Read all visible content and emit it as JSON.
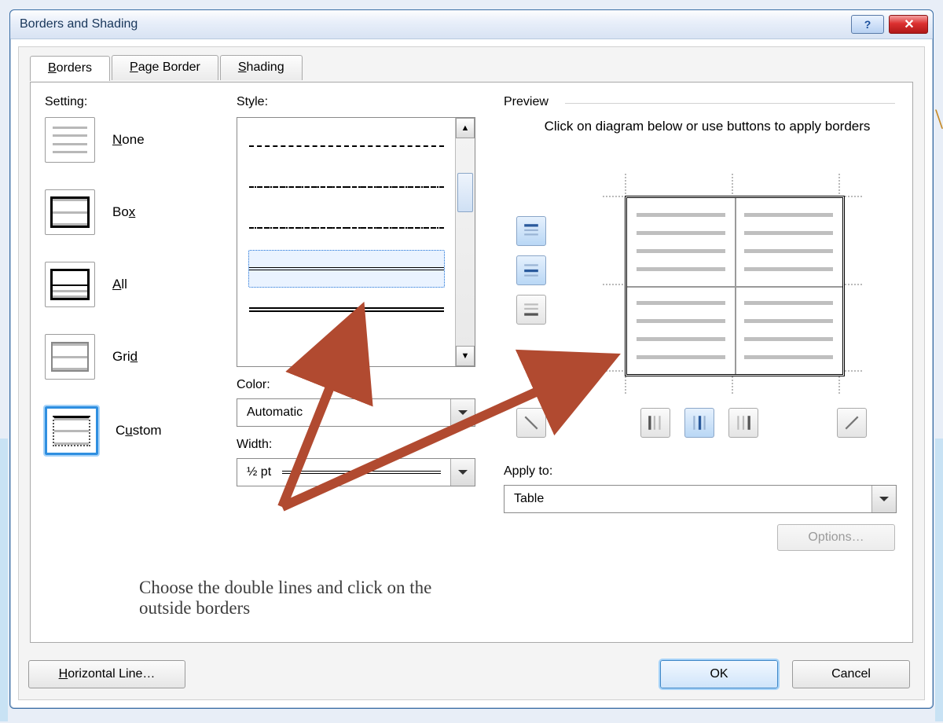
{
  "dialog": {
    "title": "Borders and Shading",
    "help_glyph": "?",
    "close_glyph": "✕"
  },
  "tabs": {
    "borders": "Borders",
    "page_border": "Page Border",
    "shading": "Shading"
  },
  "labels": {
    "setting": "Setting:",
    "style": "Style:",
    "color": "Color:",
    "width": "Width:",
    "preview": "Preview",
    "preview_help": "Click on diagram below or use buttons to apply borders",
    "apply_to": "Apply to:"
  },
  "setting_options": {
    "none": "None",
    "box": "Box",
    "all": "All",
    "grid": "Grid",
    "custom": "Custom"
  },
  "color": {
    "value": "Automatic"
  },
  "width": {
    "value": "½ pt"
  },
  "apply_to": {
    "value": "Table"
  },
  "buttons": {
    "options": "Options…",
    "horizontal_line": "Horizontal Line…",
    "ok": "OK",
    "cancel": "Cancel"
  },
  "annotation": "Choose the double lines and click on the outside borders"
}
